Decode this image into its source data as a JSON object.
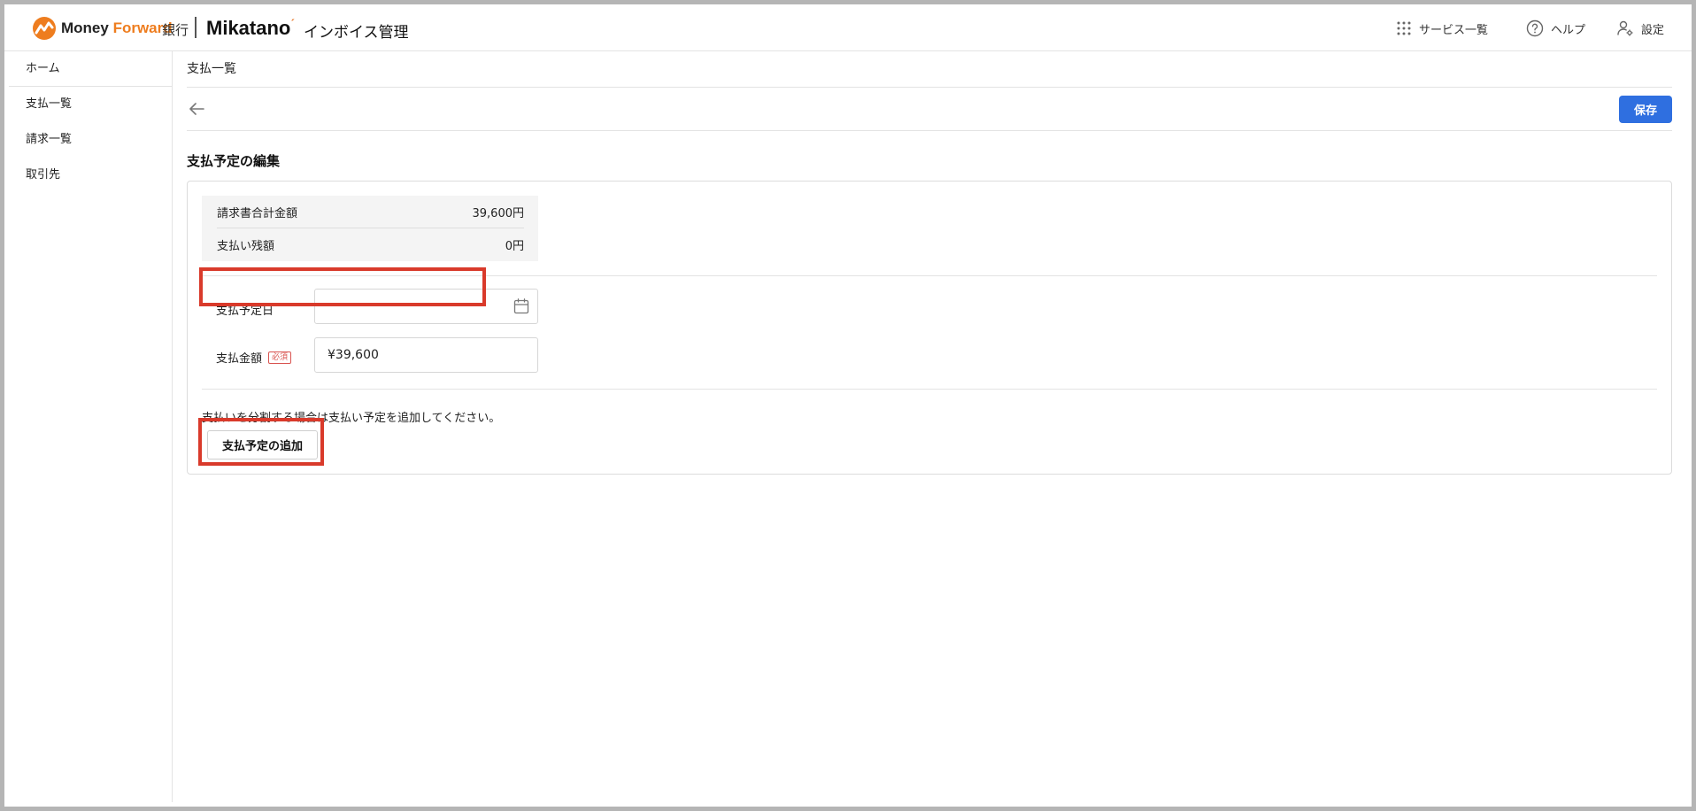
{
  "header": {
    "brand": {
      "money": "Money ",
      "forward": "Forward",
      "bank": "銀行",
      "product": "Mikatano",
      "product_sub": "インボイス管理"
    },
    "services_label": "サービス一覧",
    "help_label": "ヘルプ",
    "settings_label": "設定"
  },
  "sidebar": {
    "items": [
      {
        "label": "ホーム"
      },
      {
        "label": "支払一覧"
      },
      {
        "label": "請求一覧"
      },
      {
        "label": "取引先"
      }
    ]
  },
  "main": {
    "breadcrumb": "支払一覧",
    "save_label": "保存",
    "page_title": "支払予定の編集",
    "summary": {
      "total_label": "請求書合計金額",
      "total_value": "39,600円",
      "remaining_label": "支払い残額",
      "remaining_value": "0円"
    },
    "form": {
      "date_label": "支払予定日",
      "date_value": "",
      "amount_label": "支払金額",
      "required_badge": "必須",
      "amount_value": "¥39,600"
    },
    "hint": "支払いを分割する場合は支払い予定を追加してください。",
    "add_label": "支払予定の追加"
  },
  "colors": {
    "primary": "#2f6fe0",
    "brand_orange": "#ee7d1f",
    "highlight": "#d93a2b"
  }
}
